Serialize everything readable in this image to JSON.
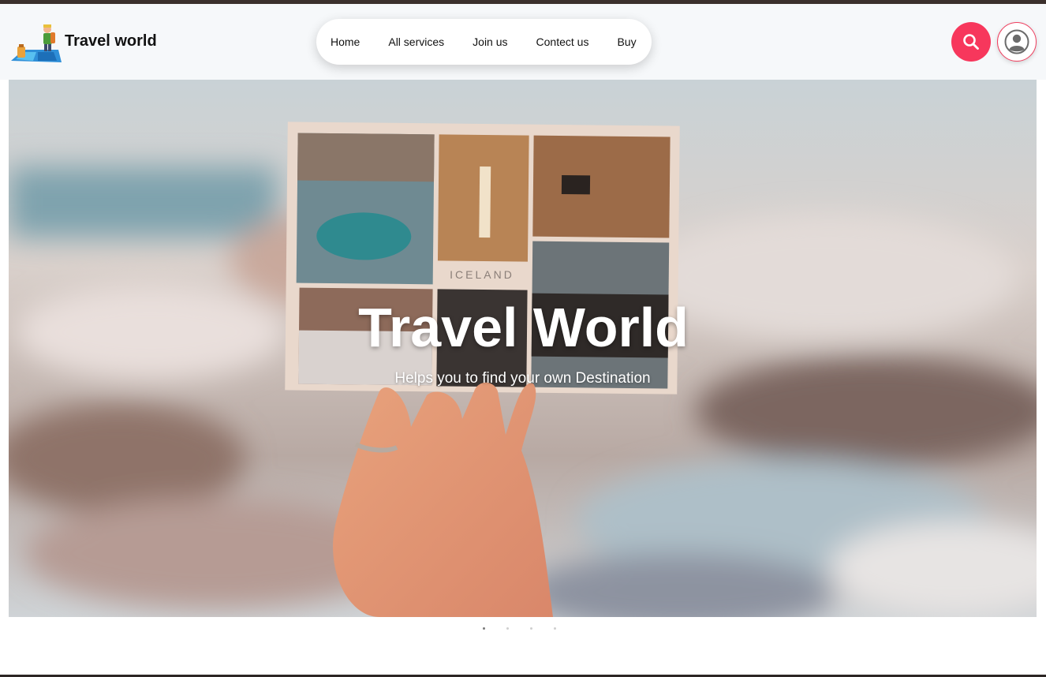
{
  "brand": {
    "name": "Travel world",
    "logo_icon": "traveler-on-map-icon"
  },
  "nav": {
    "items": [
      {
        "label": "Home"
      },
      {
        "label": "All services"
      },
      {
        "label": "Join us"
      },
      {
        "label": "Contect us"
      },
      {
        "label": "Buy"
      }
    ]
  },
  "actions": {
    "search_icon": "search-icon",
    "profile_icon": "user-profile-icon"
  },
  "hero": {
    "title": "Travel World",
    "subtitle": "Helps you to find your own Destination",
    "postcard_caption": "ICELAND",
    "active_slide": 1,
    "slide_count": 4
  },
  "colors": {
    "accent": "#f7375c",
    "header_bg": "#f6f8fa",
    "top_strip": "#3b302c"
  }
}
